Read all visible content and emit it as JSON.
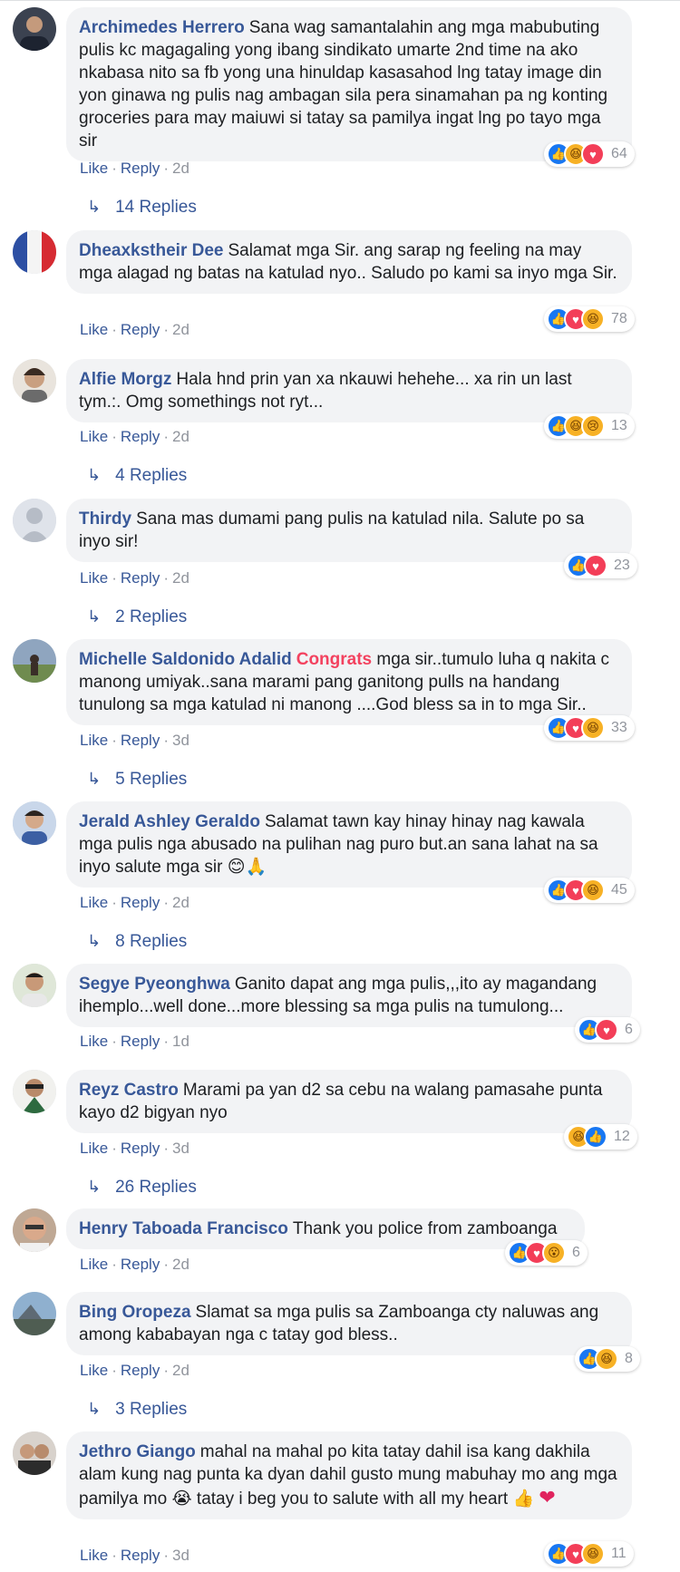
{
  "comments": [
    {
      "author": "Archimedes Herrero",
      "text": "Sana wag samantalahin ang mga mabubuting pulis kc magagaling yong ibang sindikato umarte 2nd time na ako nkabasa nito sa fb yong una hinuldap kasasahod lng tatay image din yon ginawa ng pulis nag ambagan sila pera sinamahan pa ng konting groceries para may maiuwi si tatay sa pamilya ingat lng po tayo mga sir",
      "like": "Like",
      "reply": "Reply",
      "time": "2d",
      "reactions": [
        "like",
        "haha",
        "love"
      ],
      "count": "64",
      "replies": "14 Replies"
    },
    {
      "author": "Dheaxkstheir Dee",
      "text": "Salamat mga Sir. ang sarap ng feeling na may mga alagad ng batas na katulad nyo.. Saludo po kami sa inyo mga Sir.",
      "like": "Like",
      "reply": "Reply",
      "time": "2d",
      "reactions": [
        "like",
        "love",
        "haha"
      ],
      "count": "78"
    },
    {
      "author": "Alfie Morgz",
      "text": "Hala hnd prin yan xa nkauwi hehehe... xa rin un last tym.:. Omg somethings not ryt...",
      "like": "Like",
      "reply": "Reply",
      "time": "2d",
      "reactions": [
        "like",
        "haha",
        "sad"
      ],
      "count": "13",
      "replies": "4 Replies"
    },
    {
      "author": "Thirdy",
      "text": "Sana mas dumami pang pulis na katulad nila. Salute po sa inyo sir!",
      "like": "Like",
      "reply": "Reply",
      "time": "2d",
      "reactions": [
        "like",
        "love"
      ],
      "count": "23",
      "replies": "2 Replies"
    },
    {
      "author": "Michelle Saldonido Adalid",
      "highlight": "Congrats",
      "text": "mga sir..tumulo luha q nakita c manong umiyak..sana marami pang ganitong pulls na handang tunulong sa mga katulad ni manong ....God bless sa in to mga Sir..",
      "like": "Like",
      "reply": "Reply",
      "time": "3d",
      "reactions": [
        "like",
        "love",
        "haha"
      ],
      "count": "33",
      "replies": "5 Replies"
    },
    {
      "author": "Jerald Ashley Geraldo",
      "text": "Salamat tawn kay hinay hinay nag kawala mga pulis nga abusado na pulihan nag puro but.an sana lahat na sa inyo salute mga sir",
      "emoji_end": "😊🙏",
      "like": "Like",
      "reply": "Reply",
      "time": "2d",
      "reactions": [
        "like",
        "love",
        "haha"
      ],
      "count": "45",
      "replies": "8 Replies"
    },
    {
      "author": "Segye Pyeonghwa",
      "text": "Ganito dapat ang mga pulis,,,ito ay magandang ihemplo...well done...more blessing sa mga pulis na tumulong...",
      "like": "Like",
      "reply": "Reply",
      "time": "1d",
      "reactions": [
        "like",
        "love"
      ],
      "count": "6"
    },
    {
      "author": "Reyz Castro",
      "text": "Marami pa yan d2 sa cebu na walang pamasahe punta kayo d2 bigyan nyo",
      "like": "Like",
      "reply": "Reply",
      "time": "3d",
      "reactions": [
        "haha",
        "like"
      ],
      "count": "12",
      "replies": "26 Replies"
    },
    {
      "author": "Henry Taboada Francisco",
      "text": "Thank you police from zamboanga",
      "like": "Like",
      "reply": "Reply",
      "time": "2d",
      "reactions": [
        "like",
        "love",
        "wow"
      ],
      "count": "6"
    },
    {
      "author": "Bing Oropeza",
      "text": "Slamat sa mga pulis sa Zamboanga cty naluwas ang among kababayan nga c tatay god bless..",
      "like": "Like",
      "reply": "Reply",
      "time": "2d",
      "reactions": [
        "like",
        "haha"
      ],
      "count": "8",
      "replies": "3 Replies"
    },
    {
      "author": "Jethro Giango",
      "text": "mahal na mahal po kita tatay dahil isa kang dakhila alam kung nag punta ka dyan dahil gusto mung mabuhay mo ang mga pamilya mo",
      "emoji_mid": "😭",
      "text2": "tatay i beg you to salute with all my heart",
      "emoji_end": "👍",
      "heart_end": "❤",
      "like": "Like",
      "reply": "Reply",
      "time": "3d",
      "reactions": [
        "like",
        "love",
        "haha"
      ],
      "count": "11"
    }
  ]
}
